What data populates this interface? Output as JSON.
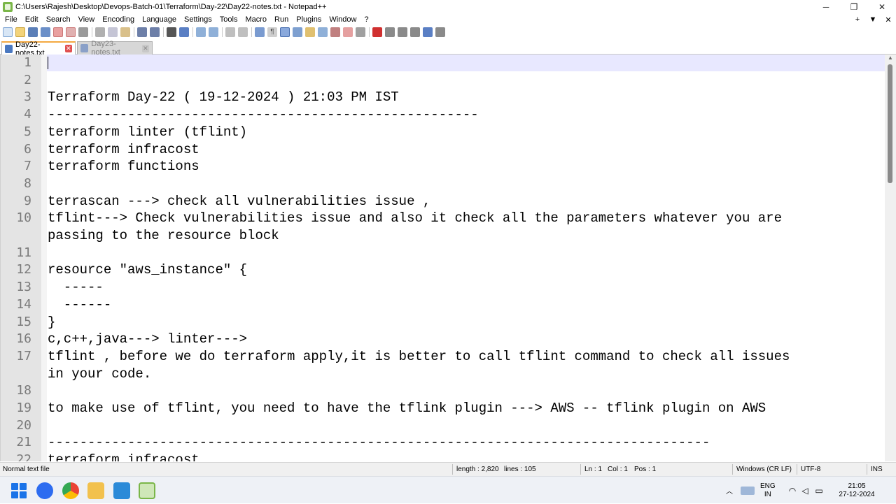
{
  "window": {
    "title": "C:\\Users\\Rajesh\\Desktop\\Devops-Batch-01\\Terraform\\Day-22\\Day22-notes.txt - Notepad++",
    "minimize": "─",
    "maximize": "❐",
    "close": "✕"
  },
  "menu": {
    "items": [
      "File",
      "Edit",
      "Search",
      "View",
      "Encoding",
      "Language",
      "Settings",
      "Tools",
      "Macro",
      "Run",
      "Plugins",
      "Window",
      "?"
    ],
    "right": [
      "+",
      "▼",
      "✕"
    ]
  },
  "tabs": [
    {
      "label": "Day22-notes.txt",
      "active": true,
      "icon": "saved-file-icon"
    },
    {
      "label": "Day23-notes.txt",
      "active": false,
      "icon": "saved-file-icon"
    }
  ],
  "editor": {
    "lines": [
      {
        "n": "1",
        "text": ""
      },
      {
        "n": "2",
        "text": ""
      },
      {
        "n": "3",
        "text": "Terraform Day-22 ( 19-12-2024 ) 21:03 PM IST"
      },
      {
        "n": "4",
        "text": "------------------------------------------------------"
      },
      {
        "n": "5",
        "text": "terraform linter (tflint)"
      },
      {
        "n": "6",
        "text": "terraform infracost"
      },
      {
        "n": "7",
        "text": "terraform functions"
      },
      {
        "n": "8",
        "text": ""
      },
      {
        "n": "9",
        "text": "terrascan ---> check all vulnerabilities issue ,"
      },
      {
        "n": "10",
        "text": "tflint---> Check vulnerabilities issue and also it check all the parameters whatever you are"
      },
      {
        "n": "",
        "text": "passing to the resource block"
      },
      {
        "n": "11",
        "text": ""
      },
      {
        "n": "12",
        "text": "resource \"aws_instance\" {"
      },
      {
        "n": "13",
        "text": "  -----"
      },
      {
        "n": "14",
        "text": "  ------"
      },
      {
        "n": "15",
        "text": "}"
      },
      {
        "n": "16",
        "text": "c,c++,java---> linter--->"
      },
      {
        "n": "17",
        "text": "tflint , before we do terraform apply,it is better to call tflint command to check all issues"
      },
      {
        "n": "",
        "text": "in your code."
      },
      {
        "n": "18",
        "text": ""
      },
      {
        "n": "19",
        "text": "to make use of tflint, you need to have the tflink plugin ---> AWS -- tflink plugin on AWS"
      },
      {
        "n": "20",
        "text": ""
      },
      {
        "n": "21",
        "text": "-----------------------------------------------------------------------------------"
      },
      {
        "n": "22",
        "text": "terraform infracost"
      }
    ]
  },
  "status": {
    "file_type": "Normal text file",
    "length": "length : 2,820",
    "lines": "lines : 105",
    "ln": "Ln : 1",
    "col": "Col : 1",
    "pos": "Pos : 1",
    "eol": "Windows (CR LF)",
    "encoding": "UTF-8",
    "mode": "INS"
  },
  "taskbar": {
    "apps": [
      "start-icon",
      "zoom-icon",
      "chrome-icon",
      "file-explorer-icon",
      "vscode-icon",
      "notepadpp-icon"
    ],
    "lang_top": "ENG",
    "lang_bottom": "IN",
    "time": "21:05",
    "date": "27-12-2024"
  },
  "colors": {
    "accent_tab": "#f4a941",
    "current_line": "#e8e8ff",
    "gutter": "#e4e4e4"
  }
}
